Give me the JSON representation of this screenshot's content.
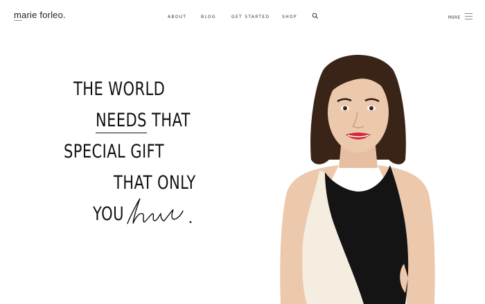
{
  "header": {
    "logo": "marie forleo.",
    "nav": {
      "about": "ABOUT",
      "blog": "BLOG",
      "get_started": "GET STARTED",
      "shop": "SHOP"
    },
    "more_label": "MORE"
  },
  "hero": {
    "line1": "THE WORLD",
    "line2_underlined": "NEEDS",
    "line2_rest": " THAT",
    "line3": "SPECIAL GIFT",
    "line4": "THAT ONLY",
    "line5": "YOU",
    "script_word": "have",
    "final_period": "."
  },
  "colors": {
    "text": "#111111",
    "background": "#ffffff",
    "dress_black": "#111111",
    "dress_cream": "#f4ede0",
    "skin": "#e8c3a8",
    "hair": "#3a2418",
    "lips": "#d02a36"
  },
  "icons": {
    "search": "search-icon",
    "menu": "hamburger-menu-icon"
  }
}
